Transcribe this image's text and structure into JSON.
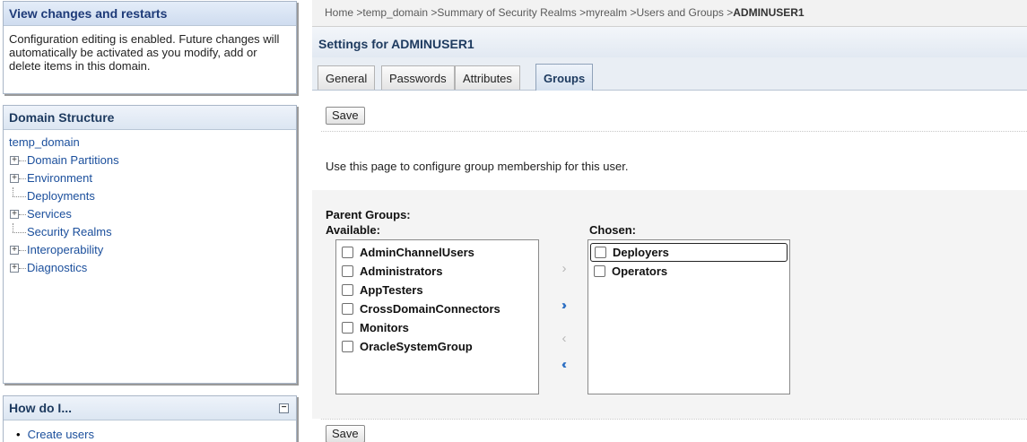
{
  "change_center": {
    "title": "View changes and restarts",
    "message": "Configuration editing is enabled. Future changes will automatically be activated as you modify, add or delete items in this domain."
  },
  "domain_structure": {
    "title": "Domain Structure",
    "root": "temp_domain",
    "items": [
      {
        "label": "Domain Partitions",
        "expandable": true
      },
      {
        "label": "Environment",
        "expandable": true
      },
      {
        "label": "Deployments",
        "expandable": false
      },
      {
        "label": "Services",
        "expandable": true
      },
      {
        "label": "Security Realms",
        "expandable": false
      },
      {
        "label": "Interoperability",
        "expandable": true
      },
      {
        "label": "Diagnostics",
        "expandable": true
      }
    ]
  },
  "how_do_i": {
    "title": "How do I...",
    "items": [
      "Create users"
    ]
  },
  "breadcrumb": {
    "items": [
      "Home",
      "temp_domain",
      "Summary of Security Realms",
      "myrealm",
      "Users and Groups"
    ],
    "current": "ADMINUSER1",
    "separator": " >"
  },
  "settings_title": "Settings for ADMINUSER1",
  "tabs": [
    {
      "label": "General",
      "active": false
    },
    {
      "label": "Passwords",
      "active": false
    },
    {
      "label": "Attributes",
      "active": false
    },
    {
      "label": "Groups",
      "active": true
    }
  ],
  "save_label": "Save",
  "description": "Use this page to configure group membership for this user.",
  "groups": {
    "parent_label": "Parent Groups:",
    "available_label": "Available:",
    "chosen_label": "Chosen:",
    "available": [
      "AdminChannelUsers",
      "Administrators",
      "AppTesters",
      "CrossDomainConnectors",
      "Monitors",
      "OracleSystemGroup"
    ],
    "chosen": [
      "Deployers",
      "Operators"
    ]
  },
  "move_buttons": [
    {
      "name": "move-right-button",
      "glyph": "›",
      "icon": "chevron-right-icon",
      "enabled": false
    },
    {
      "name": "move-all-right-button",
      "glyph": "››",
      "icon": "double-chevron-right-icon",
      "enabled": true
    },
    {
      "name": "move-left-button",
      "glyph": "‹",
      "icon": "chevron-left-icon",
      "enabled": false
    },
    {
      "name": "move-all-left-button",
      "glyph": "‹‹",
      "icon": "double-chevron-left-icon",
      "enabled": true
    }
  ],
  "colors": {
    "link": "#1b4f9c",
    "header_text": "#1d3a5f",
    "move_enabled": "#2d6fc3",
    "move_disabled": "#b8b8b8"
  }
}
